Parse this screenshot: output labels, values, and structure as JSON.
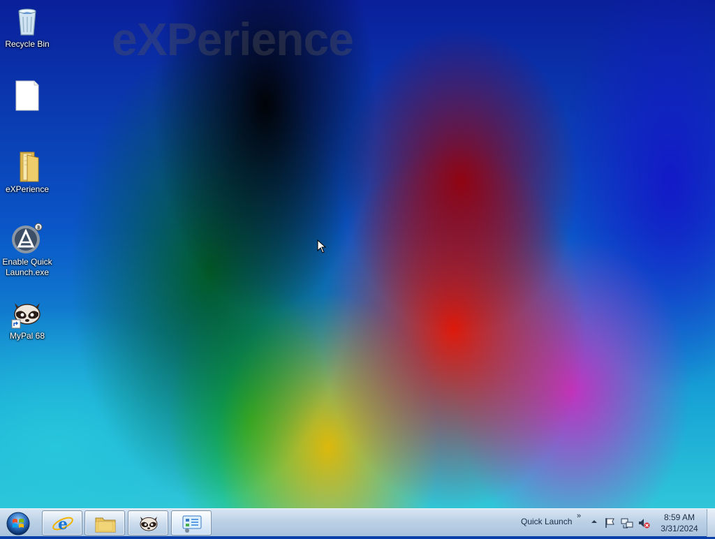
{
  "wallpaper": {
    "watermark": "eXPerience"
  },
  "desktop_icons": [
    {
      "label": "Recycle Bin",
      "icon": "recycle-bin-icon"
    },
    {
      "label": "",
      "icon": "blank-document-icon"
    },
    {
      "label": "eXPerience",
      "icon": "folder-icon"
    },
    {
      "label": "Enable Quick Launch.exe",
      "icon": "autoit-exe-icon"
    },
    {
      "label": "MyPal 68",
      "icon": "mypal-raccoon-icon"
    }
  ],
  "taskbar": {
    "start": "start-orb-icon",
    "pinned": [
      {
        "name": "Internet Explorer",
        "icon": "internet-explorer-icon"
      },
      {
        "name": "File Explorer",
        "icon": "file-explorer-icon"
      },
      {
        "name": "MyPal 68",
        "icon": "mypal-raccoon-icon"
      },
      {
        "name": "Control Panel",
        "icon": "control-panel-icon"
      }
    ],
    "quick_launch_label": "Quick Launch",
    "quick_launch_chevron": "»",
    "tray": [
      "show-hidden-icons",
      "action-center-flag-icon",
      "network-icon",
      "volume-muted-icon"
    ],
    "clock": {
      "time": "8:59 AM",
      "date": "3/31/2024"
    }
  },
  "colors": {
    "taskbar_top": "#d8e6f3",
    "taskbar_bottom": "#a9c2dc",
    "label_text": "#ffffff"
  }
}
